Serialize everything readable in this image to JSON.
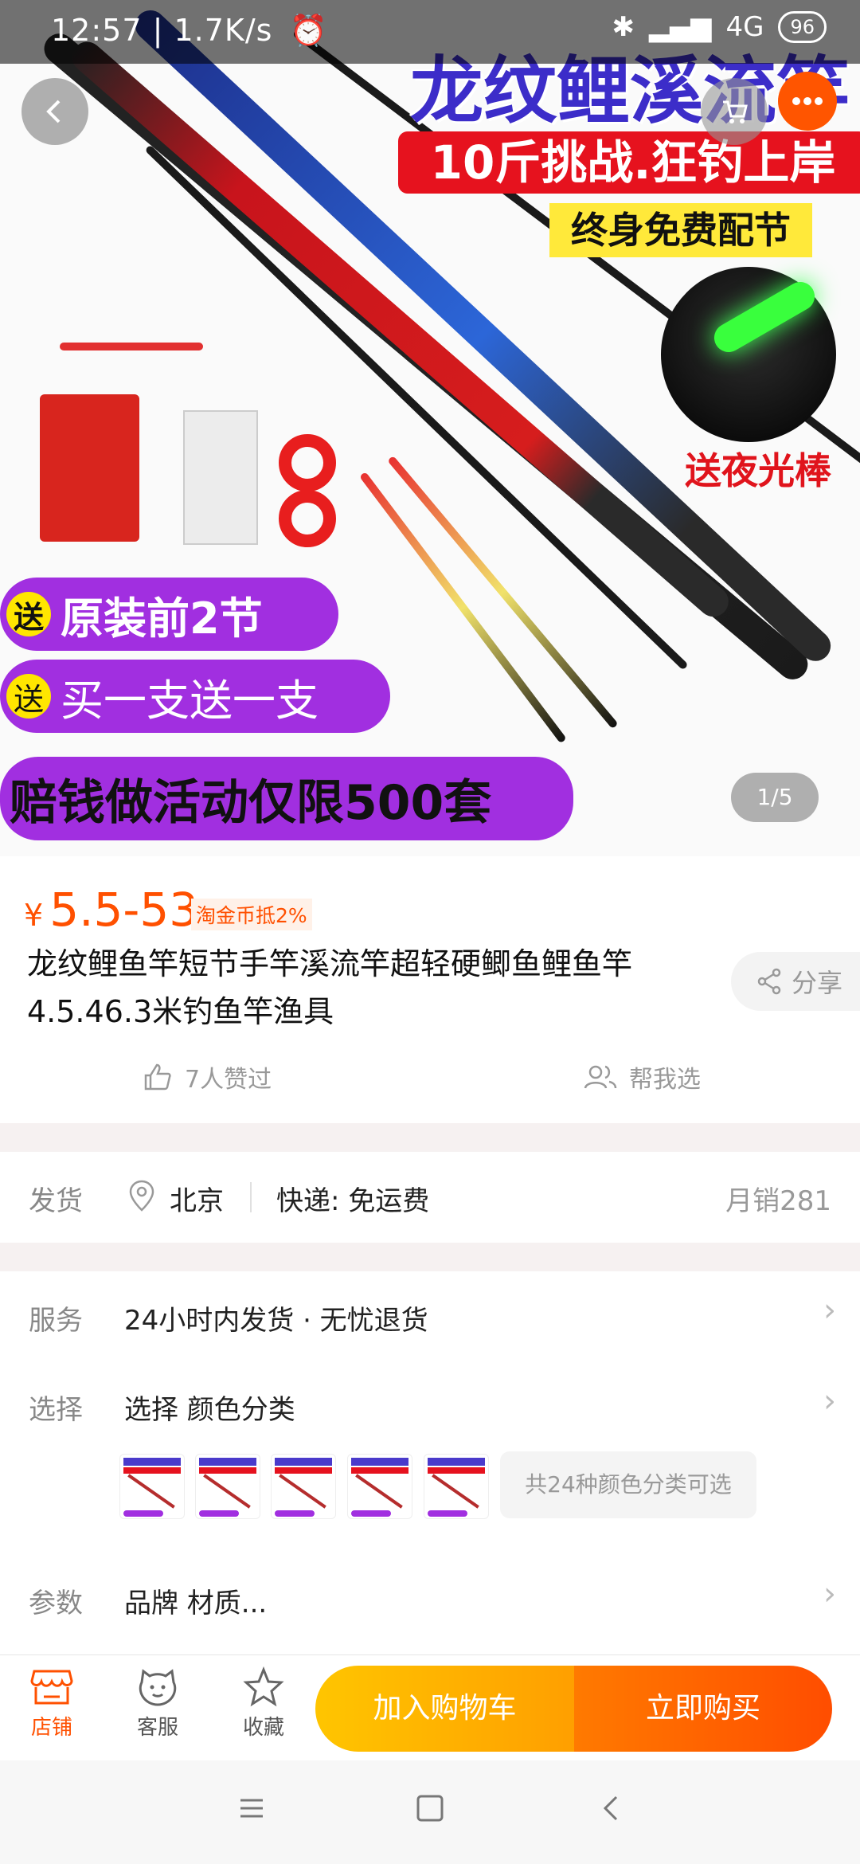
{
  "status_bar": {
    "time_speed": "12:57 | 1.7K/s",
    "alarm_icon": "alarm-icon",
    "bluetooth": "✱",
    "network": "4G",
    "battery": "96"
  },
  "hero": {
    "title": "龙纹鲤溪流竿",
    "banner_red": "10斤挑战.狂钓上岸",
    "banner_yellow": "终身免费配节",
    "night_stick": "送夜光棒",
    "promo_badge": "送",
    "promo_1": "原装前2节",
    "promo_2": "买一支送一支",
    "promo_3": "赔钱做活动仅限500套",
    "counter": "1/5"
  },
  "product": {
    "currency": "¥",
    "price": "5.5-53",
    "coin_tag": "淘金币抵2%",
    "title": "龙纹鲤鱼竿短节手竿溪流竿超轻硬鲫鱼鲤鱼竿4.5.46.3米钓鱼竿渔具",
    "share": "分享",
    "likes": "7人赞过",
    "help_choose": "帮我选"
  },
  "shipping": {
    "label": "发货",
    "city": "北京",
    "express": "快递: 免运费",
    "monthly_sales": "月销281"
  },
  "service": {
    "label": "服务",
    "value": "24小时内发货 · 无忧退货"
  },
  "select": {
    "label": "选择",
    "value": "选择 颜色分类",
    "options_count": "共24种颜色分类可选"
  },
  "params": {
    "label": "参数",
    "value": "品牌 材质..."
  },
  "action_bar": {
    "store": "店铺",
    "service": "客服",
    "favorite": "收藏",
    "add_cart": "加入购物车",
    "buy_now": "立即购买"
  },
  "colors": {
    "accent": "#ff5000",
    "cart_gradient_start": "#ffc500",
    "buy_gradient_end": "#ff4d00",
    "promo_purple": "#a12fe0"
  }
}
